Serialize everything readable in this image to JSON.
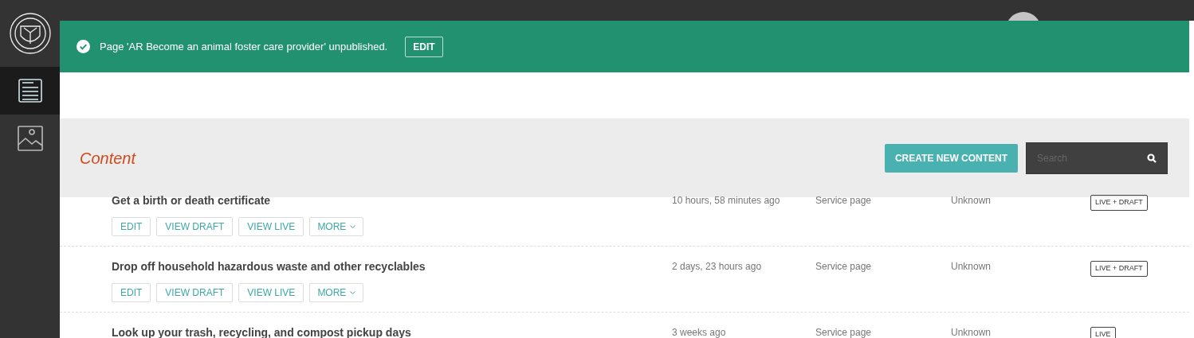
{
  "notification": {
    "message": "Page 'AR Become an animal foster care provider' unpublished.",
    "button": "EDIT"
  },
  "sidebar": {
    "items": [
      {
        "kind": "pages",
        "selected": true
      },
      {
        "kind": "images",
        "selected": false
      }
    ]
  },
  "header": {
    "title": "Content",
    "create_button": "CREATE NEW CONTENT",
    "search": {
      "placeholder": "Search"
    }
  },
  "rows": [
    {
      "title": "Get a birth or death certificate",
      "updated": "10 hours, 58 minutes ago",
      "type": "Service page",
      "owner": "Unknown",
      "status": "LIVE + DRAFT",
      "actions": [
        "EDIT",
        "VIEW DRAFT",
        "VIEW LIVE"
      ],
      "more": "MORE"
    },
    {
      "title": "Drop off household hazardous waste and other recyclables",
      "updated": "2 days, 23 hours ago",
      "type": "Service page",
      "owner": "Unknown",
      "status": "LIVE + DRAFT",
      "actions": [
        "EDIT",
        "VIEW DRAFT",
        "VIEW LIVE"
      ],
      "more": "MORE"
    },
    {
      "title": "Look up your trash, recycling, and compost pickup days",
      "updated": "3 weeks ago",
      "type": "Service page",
      "owner": "Unknown",
      "status": "LIVE"
    }
  ]
}
